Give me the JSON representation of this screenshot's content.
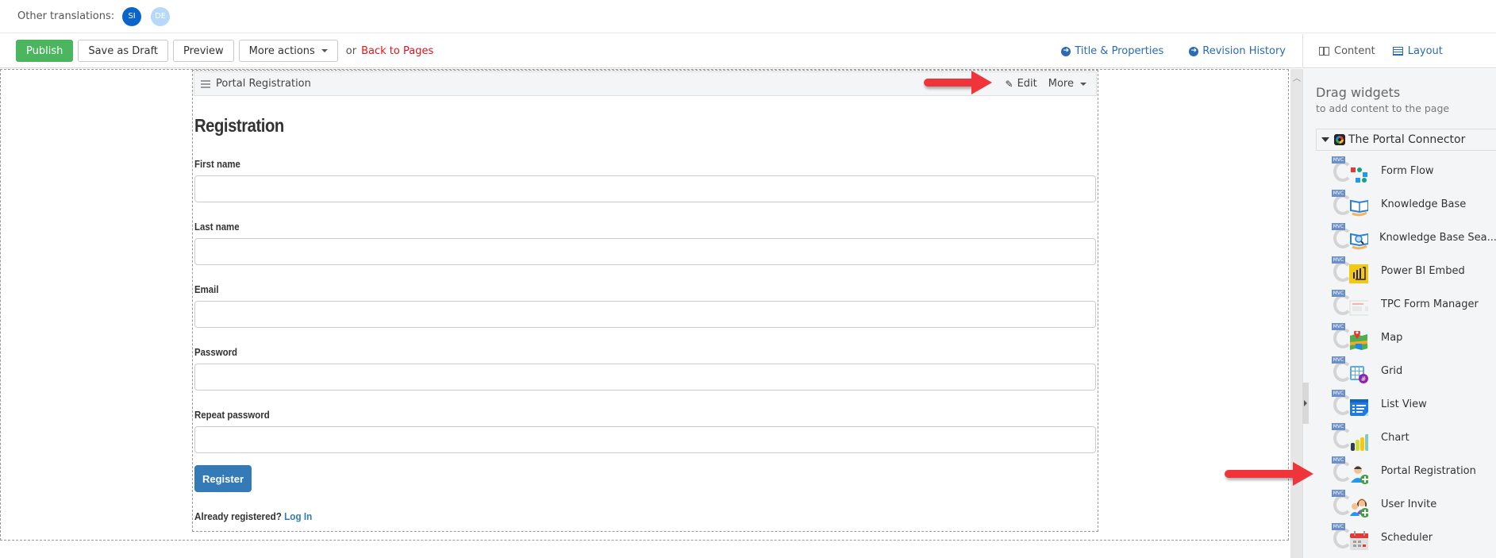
{
  "translations": {
    "label": "Other translations:",
    "languages": [
      {
        "code": "SI",
        "active": true
      },
      {
        "code": "DE",
        "active": false
      }
    ]
  },
  "toolbar": {
    "publish": "Publish",
    "save_draft": "Save as Draft",
    "preview": "Preview",
    "more_actions": "More actions",
    "or": "or",
    "back_to_pages": "Back to Pages",
    "title_properties": "Title & Properties",
    "revision_history": "Revision History"
  },
  "sidebar_tabs": {
    "content": "Content",
    "layout": "Layout"
  },
  "widget": {
    "title": "Portal Registration",
    "edit": "Edit",
    "more": "More"
  },
  "form": {
    "heading": "Registration",
    "fields": [
      {
        "label": "First name",
        "value": ""
      },
      {
        "label": "Last name",
        "value": ""
      },
      {
        "label": "Email",
        "value": ""
      },
      {
        "label": "Password",
        "value": ""
      },
      {
        "label": "Repeat password",
        "value": ""
      }
    ],
    "register_button": "Register",
    "already_registered": "Already registered?",
    "login_link": "Log In"
  },
  "sidebar": {
    "title": "Drag widgets",
    "subtitle": "to add content to the page",
    "group": "The Portal Connector",
    "badge": "MVC",
    "widgets": [
      {
        "label": "Form Flow",
        "icon": "form-flow-icon"
      },
      {
        "label": "Knowledge Base",
        "icon": "knowledge-base-icon"
      },
      {
        "label": "Knowledge Base Sea...",
        "icon": "knowledge-base-search-icon"
      },
      {
        "label": "Power BI Embed",
        "icon": "power-bi-icon"
      },
      {
        "label": "TPC Form Manager",
        "icon": "form-manager-icon"
      },
      {
        "label": "Map",
        "icon": "map-icon"
      },
      {
        "label": "Grid",
        "icon": "grid-icon"
      },
      {
        "label": "List View",
        "icon": "list-view-icon"
      },
      {
        "label": "Chart",
        "icon": "chart-icon"
      },
      {
        "label": "Portal Registration",
        "icon": "portal-registration-icon"
      },
      {
        "label": "User Invite",
        "icon": "user-invite-icon"
      },
      {
        "label": "Scheduler",
        "icon": "scheduler-icon"
      }
    ]
  },
  "colors": {
    "publish": "#4cb55f",
    "link": "#2a6bb5",
    "back_link": "#e3141a",
    "register": "#337ab7",
    "annotation_arrow": "#f0353a"
  }
}
